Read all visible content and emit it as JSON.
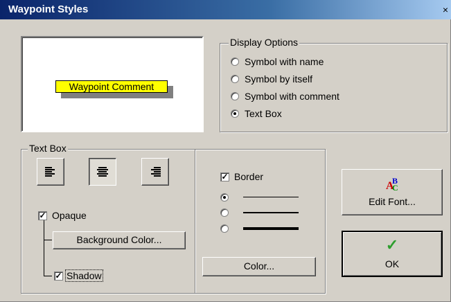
{
  "window": {
    "title": "Waypoint Styles",
    "close_glyph": "×"
  },
  "preview": {
    "sample_text": "Waypoint Comment"
  },
  "display_options": {
    "label": "Display Options",
    "options": [
      {
        "label": "Symbol with name",
        "checked": false
      },
      {
        "label": "Symbol by itself",
        "checked": false
      },
      {
        "label": "Symbol with comment",
        "checked": false
      },
      {
        "label": "Text Box",
        "checked": true
      }
    ]
  },
  "text_box": {
    "label": "Text Box",
    "alignment": {
      "left_icon": "align-left-icon",
      "center_icon": "align-center-icon",
      "right_icon": "align-right-icon",
      "selected": "center"
    },
    "opaque_label": "Opaque",
    "opaque_checked": true,
    "background_color_label": "Background Color...",
    "shadow_label": "Shadow",
    "shadow_checked": true,
    "border_label": "Border",
    "border_checked": true,
    "line_widths": [
      {
        "checked": true
      },
      {
        "checked": false
      },
      {
        "checked": false
      }
    ],
    "color_label": "Color..."
  },
  "buttons": {
    "edit_font_label": "Edit Font...",
    "ok_label": "OK",
    "ok_icon": "checkmark-icon",
    "font_icon": "font-abc-icon",
    "checkmark_glyph": "✓",
    "font_glyph_a": "A",
    "font_glyph_b": "B",
    "font_glyph_c": "C"
  },
  "colors": {
    "preview_fill": "#ffff00",
    "ok_check": "#2e9e2e",
    "font_a": "#cc0000",
    "font_b": "#0000cc",
    "font_c": "#008800"
  }
}
